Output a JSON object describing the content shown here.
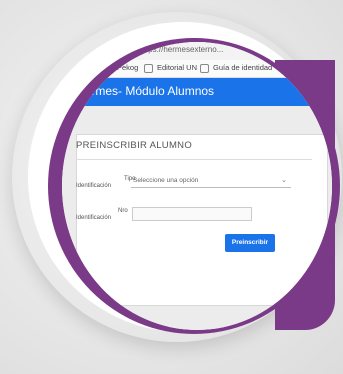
{
  "browser": {
    "url": "Seguro | https://hermesexterno..."
  },
  "bookmarks": [
    {
      "label": "Pekog"
    },
    {
      "label": "Editorial UN"
    },
    {
      "label": "Guía de identidad"
    }
  ],
  "app": {
    "title": "Hermes- Módulo Alumnos",
    "accent": "#1a73e8"
  },
  "form": {
    "card_title": "PREINSCRIBIR ALUMNO",
    "tipo_label_line1": "Tipo",
    "tipo_label_line2": "Identificación",
    "tipo_value": "Seleccione una opción",
    "num_label_line1": "Nro",
    "num_label_line2": "Identificación",
    "num_value": "",
    "submit_label": "Preinscribir"
  },
  "decor": {
    "ring_color": "#7b3a87"
  }
}
